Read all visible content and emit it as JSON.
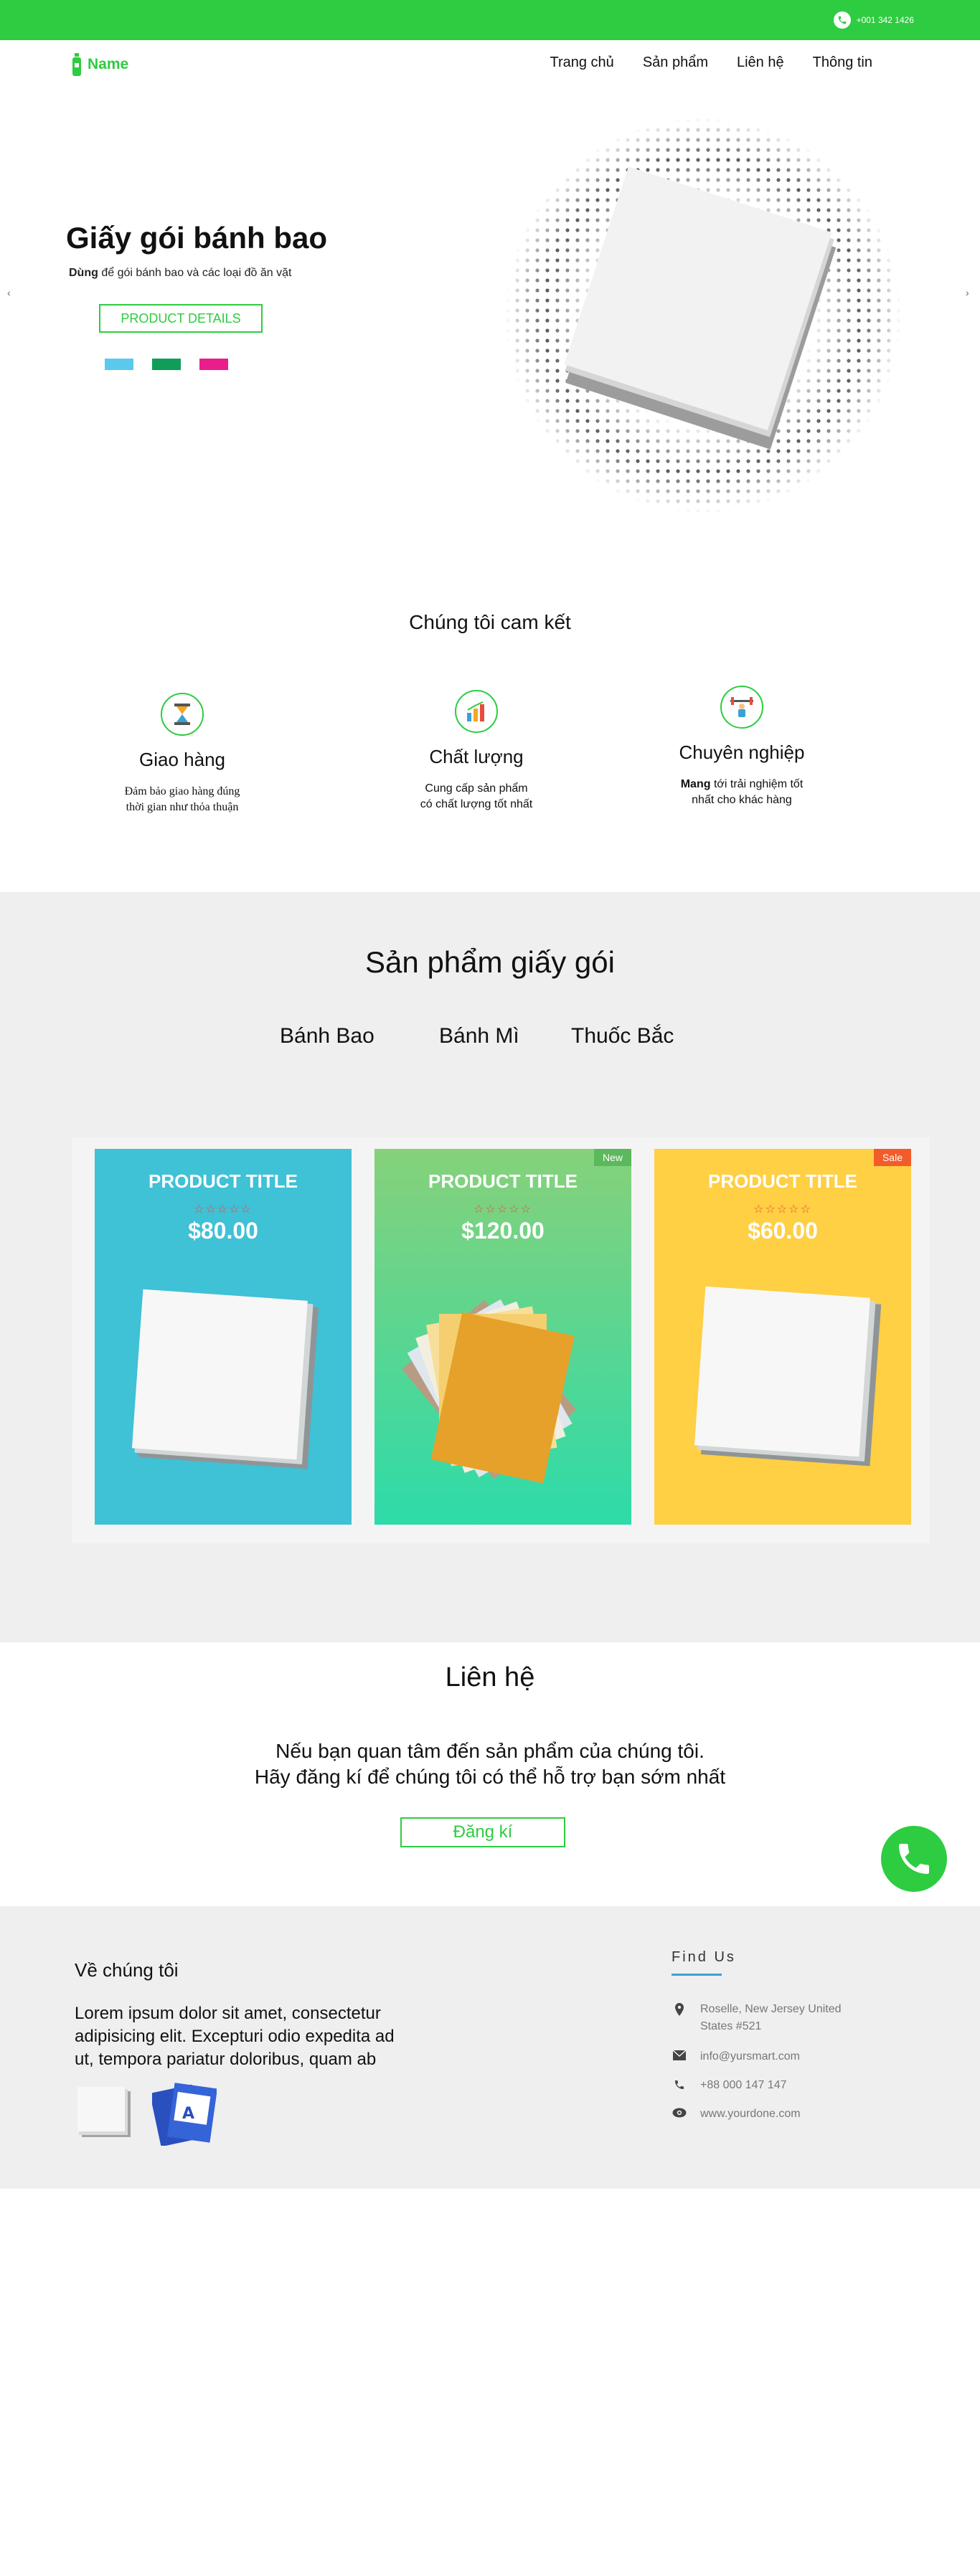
{
  "header": {
    "phone": "+001 342 1426",
    "logo_text": "Name",
    "nav": [
      "Trang chủ",
      "Sản phẩm",
      "Liên hệ",
      "Thông tin"
    ]
  },
  "hero": {
    "title": "Giấy gói bánh bao",
    "subtitle_bold": "Dùng",
    "subtitle_rest": " để gói bánh bao và các loại đồ ăn vặt",
    "button": "PRODUCT DETAILS",
    "swatches": [
      "#5bc9ec",
      "#0f9d58",
      "#e91e8c"
    ],
    "prev": "‹",
    "next": "›"
  },
  "commit": {
    "title": "Chúng tôi cam kết",
    "features": [
      {
        "icon": "hourglass-icon",
        "title": "Giao hàng",
        "desc": "Đảm bảo giao hàng đúng\nthời gian  như thỏa thuận"
      },
      {
        "icon": "chart-icon",
        "title": "Chất lượng",
        "desc": "Cung cấp sản phẩm\ncó chất lượng tốt nhất"
      },
      {
        "icon": "weightlifter-icon",
        "title": "Chuyên nghiệp",
        "desc_bold": "Mang",
        "desc": " tới trải nghiệm tốt\nnhất cho khác hàng"
      }
    ]
  },
  "products": {
    "title": "Sản phẩm giấy gói",
    "categories": [
      "Bánh Bao",
      "Bánh Mì",
      "Thuốc Bắc"
    ],
    "cards": [
      {
        "title": "PRODUCT TITLE",
        "stars": "☆☆☆☆☆",
        "price": "$80.00",
        "badge": "",
        "color": "#3fc1d6"
      },
      {
        "title": "PRODUCT TITLE",
        "stars": "☆☆☆☆☆",
        "price": "$120.00",
        "badge": "New",
        "badge_color": "#5cb85c"
      },
      {
        "title": "PRODUCT TITLE",
        "stars": "☆☆☆☆☆",
        "price": "$60.00",
        "badge": "Sale",
        "badge_color": "#f25c2a",
        "color": "#ffcf44"
      }
    ]
  },
  "contact": {
    "title": "Liên hệ",
    "line1": "Nếu bạn quan tâm đến sản phẩm của chúng tôi.",
    "line2": "Hãy đăng kí để chúng tôi có thể hỗ trợ bạn sớm nhất",
    "button": "Đăng kí"
  },
  "footer": {
    "about_title": "Về chúng tôi",
    "about_text": "Lorem ipsum dolor sit amet, consectetur adipisicing elit. Excepturi odio expedita ad  ut, tempora pariatur doloribus, quam ab",
    "find_title": "Find Us",
    "address": "Roselle, New Jersey United States #521",
    "email": "info@yursmart.com",
    "phone": "+88 000 147 147",
    "website": "www.yourdone.com"
  },
  "colors": {
    "brand": "#2ecc40",
    "footer_bg": "#efefef"
  }
}
